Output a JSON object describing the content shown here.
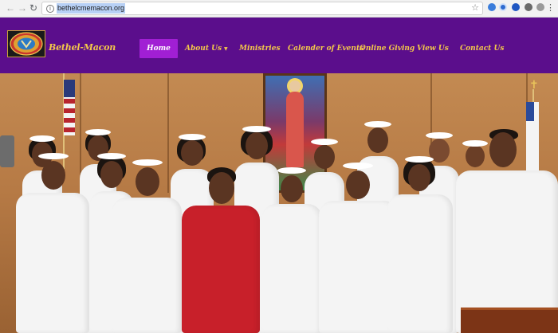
{
  "browser": {
    "url": "bethelcmemacon.org",
    "back_icon": "arrow-left-icon",
    "forward_icon": "arrow-right-icon",
    "reload_icon": "reload-icon",
    "info_icon": "info-icon",
    "bookmark_icon": "star-icon",
    "menu_icon": "kebab-menu-icon"
  },
  "site": {
    "name": "Bethel-Macon",
    "logo_icon": "church-seal-logo",
    "colors": {
      "header_bg": "#5b0e8c",
      "nav_text": "#f3c84a",
      "active_bg": "#a11fd4"
    }
  },
  "nav": {
    "items": [
      {
        "label": "Home",
        "active": true
      },
      {
        "label": "About Us",
        "dropdown": true
      },
      {
        "label": "Ministries"
      },
      {
        "label": "Calender of Events"
      },
      {
        "label": "Online Giving"
      },
      {
        "label": "View Us"
      },
      {
        "label": "Contact Us"
      }
    ]
  },
  "hero": {
    "image": "group-photo-church-choir"
  }
}
